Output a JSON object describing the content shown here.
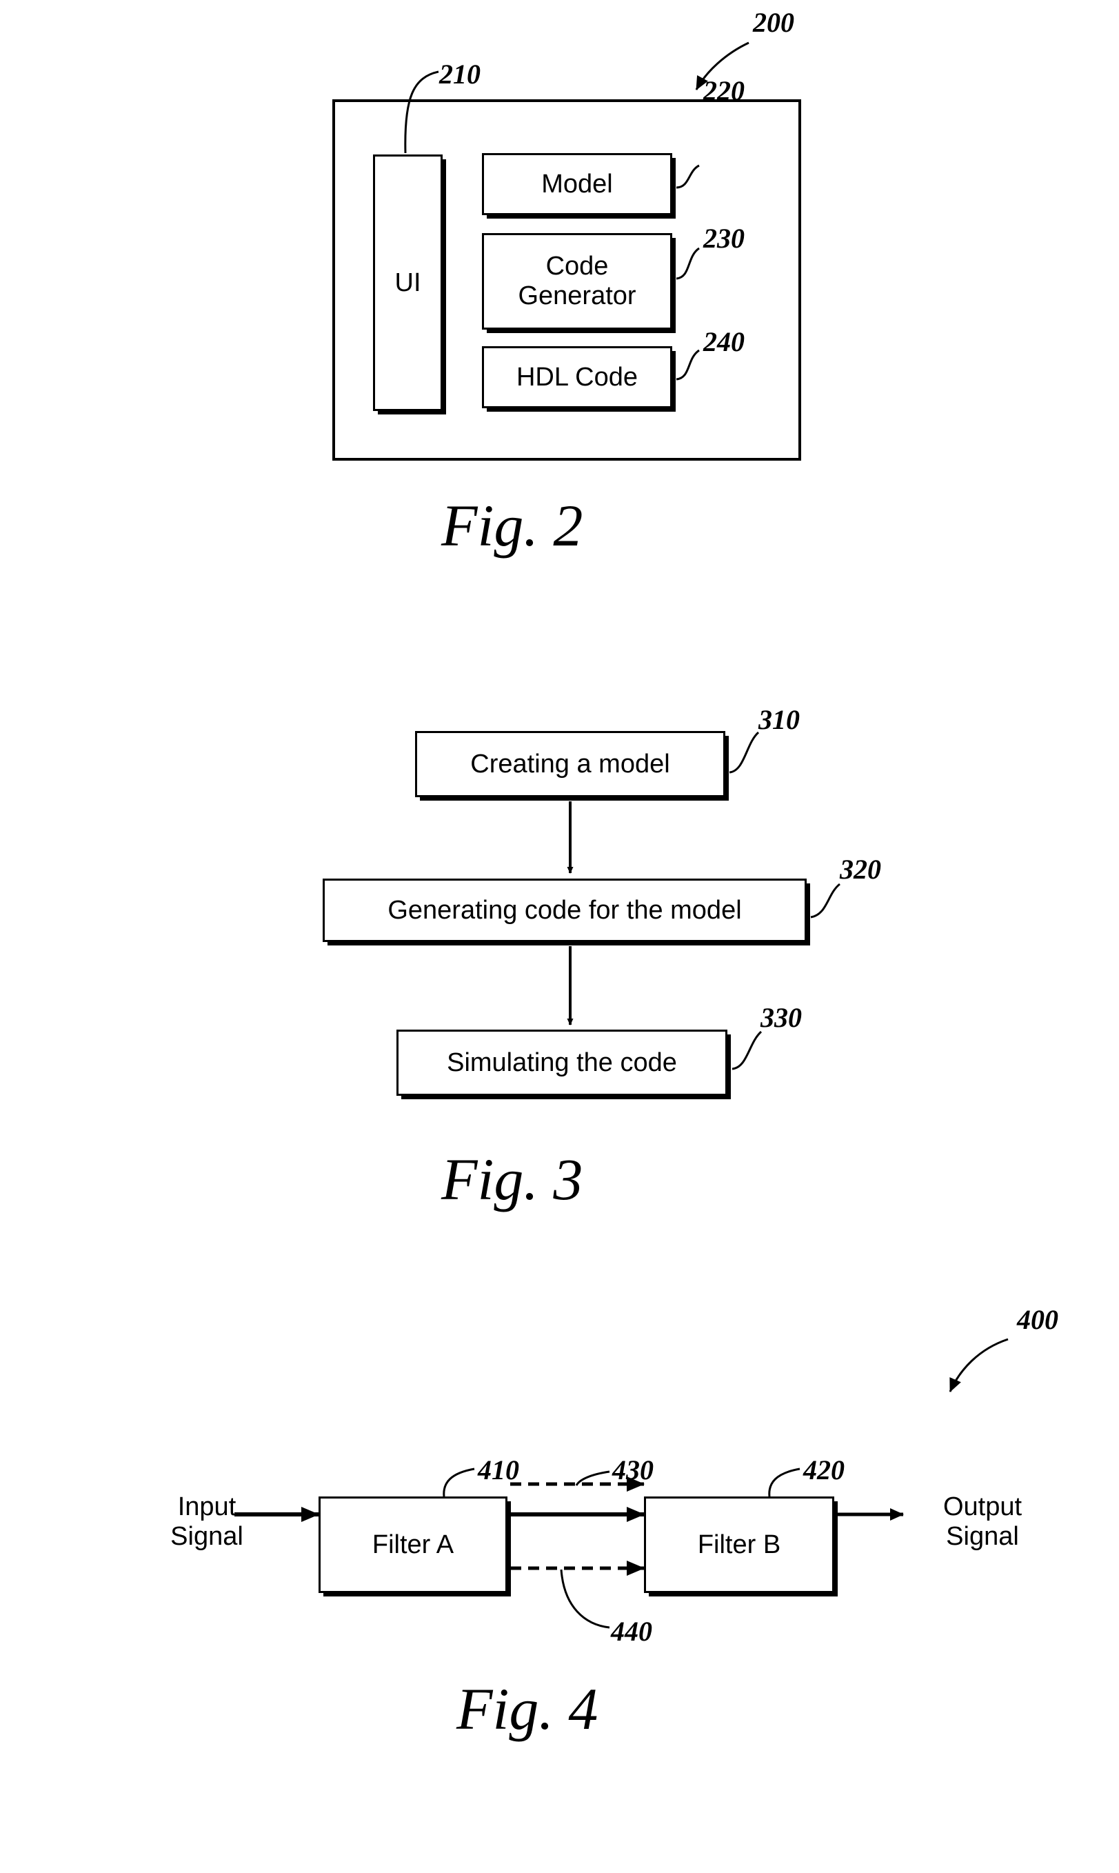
{
  "sheet": {
    "figures": [
      {
        "id": "fig2",
        "caption": "Fig. 2",
        "system_ref": "200",
        "boxes": [
          {
            "key": "ui",
            "label": "UI",
            "ref": "210"
          },
          {
            "key": "model",
            "label": "Model",
            "ref": "220"
          },
          {
            "key": "codegen",
            "label": "Code\nGenerator",
            "ref": "230"
          },
          {
            "key": "hdl",
            "label": "HDL Code",
            "ref": "240"
          }
        ]
      },
      {
        "id": "fig3",
        "caption": "Fig. 3",
        "steps": [
          {
            "key": "step1",
            "label": "Creating a model",
            "ref": "310"
          },
          {
            "key": "step2",
            "label": "Generating code for the model",
            "ref": "320"
          },
          {
            "key": "step3",
            "label": "Simulating the code",
            "ref": "330"
          }
        ]
      },
      {
        "id": "fig4",
        "caption": "Fig. 4",
        "system_ref": "400",
        "input_label": "Input\nSignal",
        "output_label": "Output\nSignal",
        "blocks": [
          {
            "key": "filter_a",
            "label": "Filter A",
            "ref": "410"
          },
          {
            "key": "filter_b",
            "label": "Filter B",
            "ref": "420"
          }
        ],
        "signal_refs": [
          {
            "key": "upper_dashed",
            "ref": "430"
          },
          {
            "key": "lower_dashed",
            "ref": "440"
          }
        ]
      }
    ]
  },
  "fig2": {
    "ref_200": "200",
    "ref_210": "210",
    "ref_220": "220",
    "ref_230": "230",
    "ref_240": "240",
    "ui_label": "UI",
    "model_label": "Model",
    "codegen_line1": "Code",
    "codegen_line2": "Generator",
    "hdl_label": "HDL Code",
    "caption": "Fig. 2"
  },
  "fig3": {
    "ref_310": "310",
    "ref_320": "320",
    "ref_330": "330",
    "step1_label": "Creating a model",
    "step2_label": "Generating code for the model",
    "step3_label": "Simulating the code",
    "caption": "Fig. 3"
  },
  "fig4": {
    "ref_400": "400",
    "ref_410": "410",
    "ref_420": "420",
    "ref_430": "430",
    "ref_440": "440",
    "input_line1": "Input",
    "input_line2": "Signal",
    "output_line1": "Output",
    "output_line2": "Signal",
    "filter_a_label": "Filter A",
    "filter_b_label": "Filter B",
    "caption": "Fig. 4"
  },
  "colors": {
    "ink": "#000000",
    "paper": "#ffffff"
  }
}
